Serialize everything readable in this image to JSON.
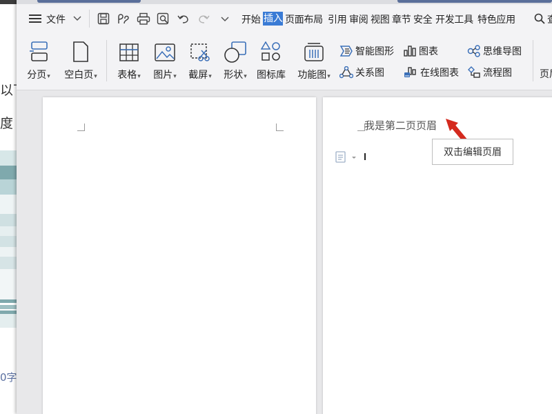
{
  "bg_window": {
    "line1": "以下",
    "line2": "度",
    "wordcount": "0字"
  },
  "menubar": {
    "menu_label": "文件",
    "tabs": [
      {
        "label": "开始",
        "active": false
      },
      {
        "label": "插入",
        "active": true
      },
      {
        "label": "页面布局",
        "active": false
      },
      {
        "label": "引用",
        "active": false
      },
      {
        "label": "审阅",
        "active": false
      },
      {
        "label": "视图",
        "active": false
      },
      {
        "label": "章节",
        "active": false
      },
      {
        "label": "安全",
        "active": false
      },
      {
        "label": "开发工具",
        "active": false
      },
      {
        "label": "特色应用",
        "active": false
      }
    ],
    "search_label": "查"
  },
  "ribbon": {
    "page_break": "分页",
    "blank_page": "空白页",
    "table": "表格",
    "picture": "图片",
    "screenshot": "截屏",
    "shape": "形状",
    "icon_library": "图标库",
    "function_chart": "功能图",
    "smart_graphic": "智能图形",
    "chart": "图表",
    "mind_map": "思维导图",
    "relation_chart": "关系图",
    "online_chart": "在线图表",
    "flowchart": "流程图",
    "header_footer": "页眉"
  },
  "document": {
    "page2_header": "我是第二页页眉",
    "tooltip": "双击编辑页眉",
    "accent_color": "#3a7bd5",
    "arrow_color": "#d42a1e"
  }
}
